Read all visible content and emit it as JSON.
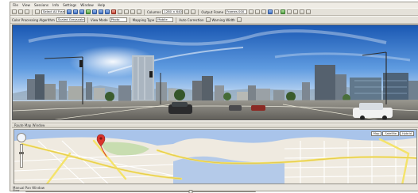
{
  "menu": [
    "File",
    "View",
    "Sessions",
    "Info",
    "Settings",
    "Window",
    "Help"
  ],
  "toolbar": {
    "select_all_frames_label": "Select All Frames",
    "columns_label": "Columns",
    "columns_value": "1280 × 640",
    "output_frame_label": "Output Frame",
    "output_frame_value": "Frames 000"
  },
  "toolbar2": {
    "processing_label": "Color Processing Algorithm",
    "processing_value": "Scaled Greyscale",
    "view_mode_label": "View Mode",
    "view_mode_value": "Photo",
    "mapping_type_label": "Mapping Type",
    "mapping_type_value": "Mobile",
    "auto_correction_label": "Auto Correction",
    "warning_label": "Warning Width"
  },
  "map_panel": {
    "title": "Route Map Window",
    "buttons": [
      "Map",
      "Satellite",
      "Hybrid"
    ]
  },
  "bottom": {
    "status_label": "Manual Pan Window",
    "speed_label": "Slow",
    "speed_value": 0.72
  },
  "icons": {
    "toolbar": [
      "open-icon",
      "save-icon",
      "print-icon",
      "play-icon",
      "step-back-icon",
      "step-forward-icon",
      "zoom-icon"
    ],
    "map": [
      "pan-control-icon",
      "zoom-slider-icon",
      "location-marker-icon"
    ]
  },
  "colors": {
    "window_bg": "#e9e6df",
    "sky_top": "#1a58b3",
    "sky_mid": "#6aa3e0",
    "road_yellow": "#f4e36a",
    "water": "#a9c4ea",
    "marker": "#d9342b"
  }
}
